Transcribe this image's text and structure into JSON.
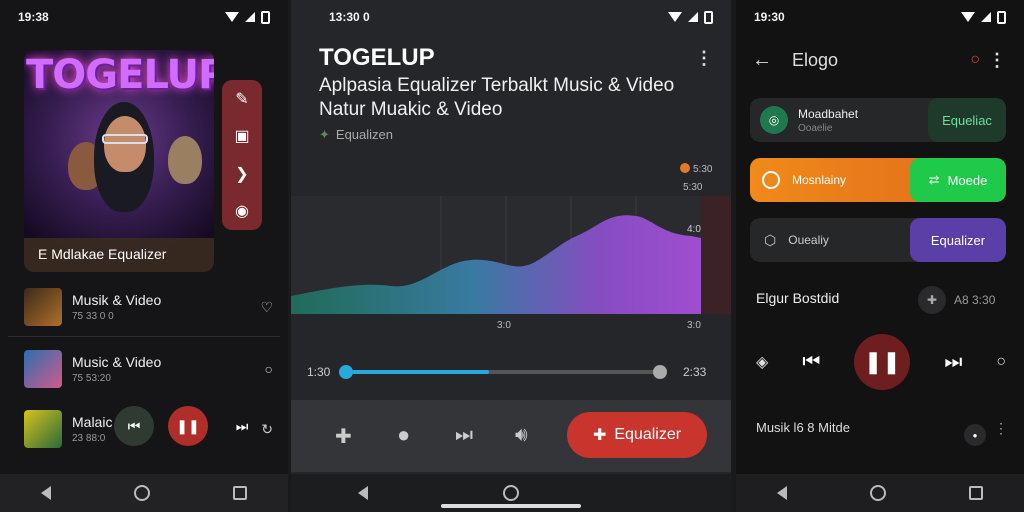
{
  "phone1": {
    "status_time": "19:38",
    "album_title": "TOGELUP",
    "album_label": "E Mdlakae Equalizer",
    "tracks": [
      {
        "title": "Musik & Video",
        "subtitle": "75 33 0 0"
      },
      {
        "title": "Music & Video",
        "subtitle": "75 53:20"
      },
      {
        "title": "Malaic",
        "subtitle": "23 88:0"
      }
    ]
  },
  "phone2": {
    "status_time": "13:30 0",
    "title": "TOGELUP",
    "subtitle": "Aplpasia Equalizer Terbalkt Music & Video Natur Muakic & Video",
    "section_label": "Equalizen",
    "legend_value_1": "5:30",
    "legend_value_2": "5:30",
    "chart_top_label": "4:0",
    "chart_bottom_left": "3:0",
    "chart_bottom_right": "3:0",
    "time_elapsed": "1:30",
    "time_total": "2:33",
    "equalizer_button": "Equalizer",
    "seek_progress": 0.46
  },
  "phone3": {
    "status_time": "19:30",
    "header_title": "Elogo",
    "cards": [
      {
        "title": "Moadbahet",
        "subtitle": "Ooaelie",
        "pill": "Equeliac"
      },
      {
        "title": "Mosnlainy",
        "pill": "Moede"
      },
      {
        "title": "Ouealiy",
        "pill": "Equalizer"
      }
    ],
    "section_title": "Elgur Bostdid",
    "section_meta": "A8 3:30",
    "now_playing": "Musik l6 8 Mitde"
  },
  "colors": {
    "accent_red": "#c9352d",
    "accent_blue": "#29a8e0",
    "accent_green": "#1fc94a",
    "accent_purple": "#5a3fa8",
    "accent_orange": "#f07a1a"
  }
}
